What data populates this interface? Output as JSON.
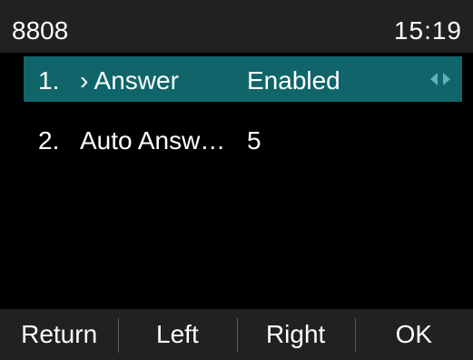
{
  "status": {
    "extension": "8808",
    "time": "15:19"
  },
  "list": {
    "items": [
      {
        "index": "1.",
        "label": "› Answer",
        "value": "Enabled",
        "selected": true
      },
      {
        "index": "2.",
        "label": "Auto Answ…",
        "value": "5",
        "selected": false
      }
    ],
    "arrow_icons": [
      "arrow-left-icon",
      "arrow-right-icon"
    ]
  },
  "softkeys": [
    "Return",
    "Left",
    "Right",
    "OK"
  ],
  "colors": {
    "selection": "#10656a",
    "bar": "#212121",
    "arrow": "#5fb2b6"
  }
}
